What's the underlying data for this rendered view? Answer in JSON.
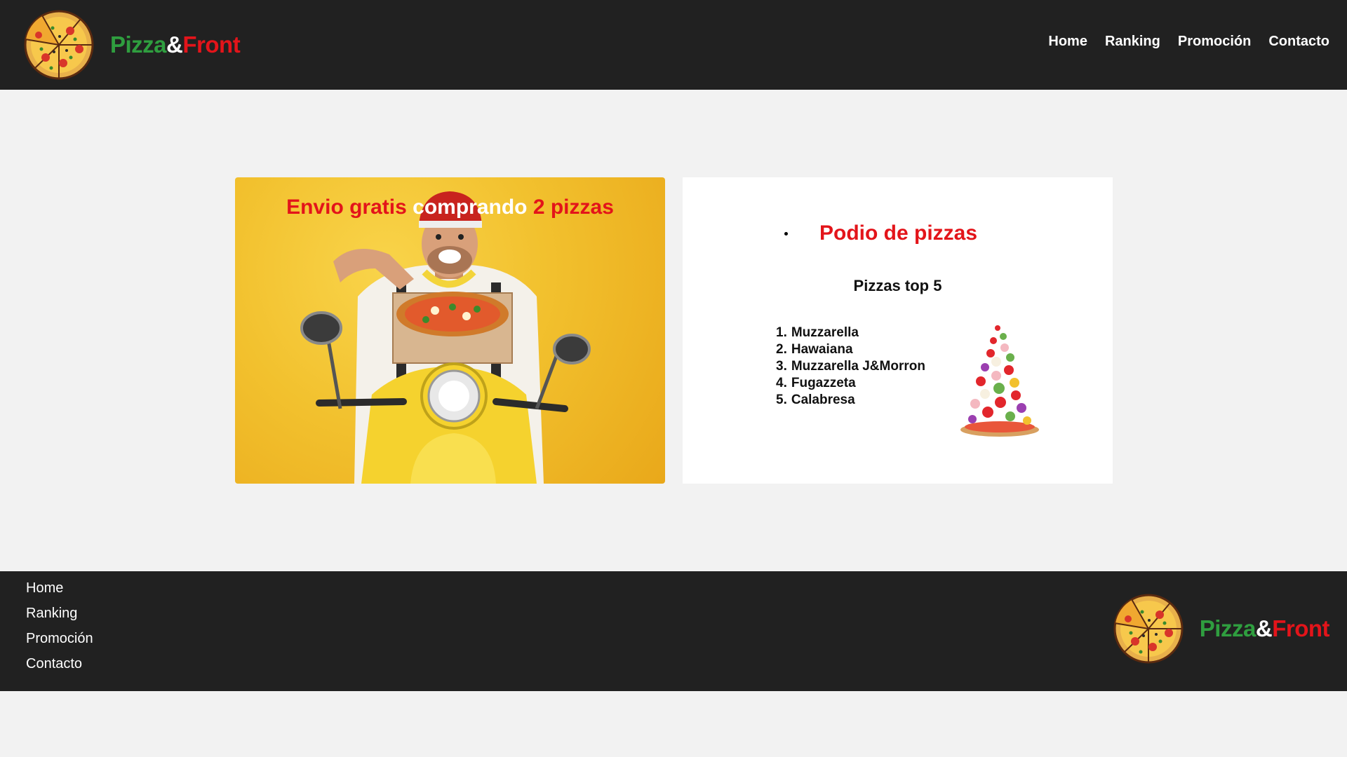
{
  "header": {
    "brand": {
      "part1": "Pizza",
      "part2": "&",
      "part3": "Front"
    },
    "nav": [
      {
        "label": "Home"
      },
      {
        "label": "Ranking"
      },
      {
        "label": "Promoción"
      },
      {
        "label": "Contacto"
      }
    ]
  },
  "promo": {
    "title_part1": "Envio gratis ",
    "title_part2": "comprando ",
    "title_part3": "2 pizzas"
  },
  "ranking": {
    "title": "Podio de pizzas",
    "subtitle": "Pizzas top 5",
    "items": [
      {
        "num": "1.",
        "name": "Muzzarella"
      },
      {
        "num": "2.",
        "name": "Hawaiana"
      },
      {
        "num": "3.",
        "name": "Muzzarella J&Morron"
      },
      {
        "num": "4.",
        "name": "Fugazzeta"
      },
      {
        "num": "5.",
        "name": "Calabresa"
      }
    ]
  },
  "footer": {
    "links": [
      {
        "label": "Home"
      },
      {
        "label": "Ranking"
      },
      {
        "label": "Promoción"
      },
      {
        "label": "Contacto"
      }
    ],
    "brand": {
      "part1": "Pizza",
      "part2": "&",
      "part3": "Front"
    }
  },
  "colors": {
    "header_bg": "#212121",
    "page_bg": "#f2f2f2",
    "brand_green": "#2f9e3f",
    "brand_red": "#e3141a",
    "promo_yellow": "#f2c12e"
  },
  "icons": {
    "logo": "pizza-logo-icon",
    "promo_image": "delivery-scooter-image",
    "ranking_image": "pizza-tower-image"
  }
}
